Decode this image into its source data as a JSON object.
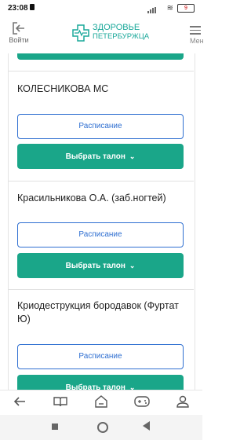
{
  "status_bar": {
    "time": "23:08",
    "battery": "9"
  },
  "header": {
    "login_label": "Войти",
    "logo_line1": "ЗДОРОВЬЕ",
    "logo_line2": "ПЕТЕРБУРЖЦА",
    "menu_label": "Мен"
  },
  "doctors": [
    {
      "name": "КОЛЕСНИКОВА МС",
      "schedule_label": "Расписание",
      "ticket_label": "Выбрать талон"
    },
    {
      "name": "Красильникова О.А. (заб.ногтей)",
      "schedule_label": "Расписание",
      "ticket_label": "Выбрать талон"
    },
    {
      "name": "Криодеструкция бородавок (Фуртат Ю)",
      "schedule_label": "Расписание",
      "ticket_label": "Выбрать талон"
    }
  ],
  "colors": {
    "accent_green": "#1aa689",
    "outline_blue": "#2f6fd1",
    "logo_teal": "#1aa89a"
  },
  "bottom_nav_icons": [
    "back-icon",
    "book-icon",
    "home-icon",
    "gamepad-icon",
    "profile-icon"
  ]
}
